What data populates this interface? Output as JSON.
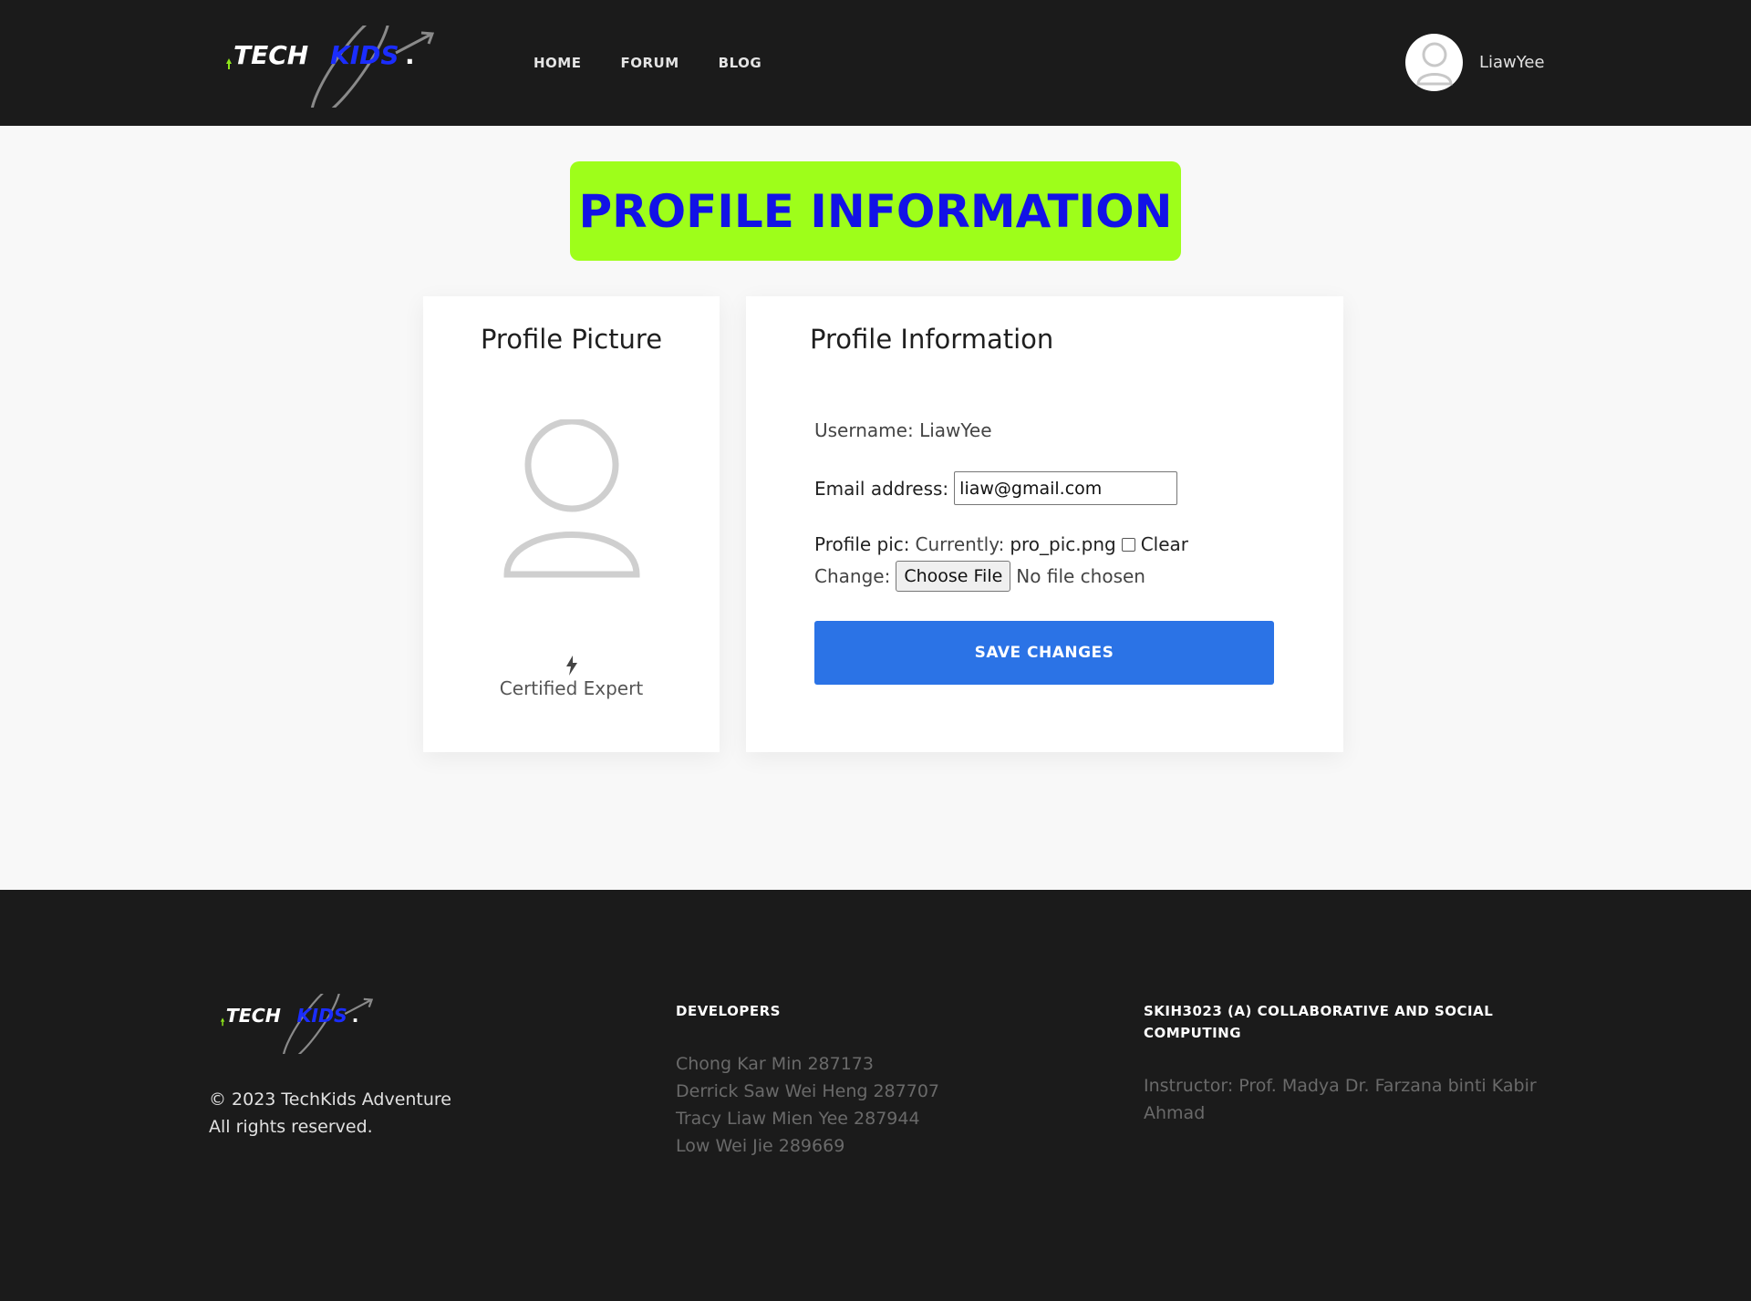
{
  "header": {
    "logo": {
      "part1": "TECH",
      "part2": "KIDS",
      "part3": "."
    },
    "nav": [
      "HOME",
      "FORUM",
      "BLOG"
    ],
    "user_name": "LiawYee"
  },
  "banner": {
    "title": "PROFILE INFORMATION"
  },
  "picture_card": {
    "title": "Profile Picture",
    "badge_icon": "bolt-icon",
    "badge_label": "Certified Expert"
  },
  "info_card": {
    "title": "Profile Information",
    "username_label": "Username:",
    "username_value": "LiawYee",
    "email_label": "Email address:",
    "email_value": "liaw@gmail.com",
    "pic_label": "Profile pic:",
    "currently_label": "Currently:",
    "current_file": "pro_pic.png",
    "clear_label": "Clear",
    "change_label": "Change:",
    "choose_file": "Choose File",
    "no_file": "No file chosen",
    "save_label": "SAVE CHANGES"
  },
  "footer": {
    "copyright": "© 2023 TechKids Adventure",
    "rights": "All rights reserved.",
    "developers_title": "DEVELOPERS",
    "developers": [
      "Chong Kar Min 287173",
      "Derrick Saw Wei Heng 287707",
      "Tracy Liaw Mien Yee 287944",
      "Low Wei Jie 289669"
    ],
    "course_title": "SKIH3023 (A) COLLABORATIVE AND SOCIAL COMPUTING",
    "instructor": "Instructor: Prof. Madya Dr. Farzana binti Kabir Ahmad"
  },
  "colors": {
    "header_bg": "#1b1b1b",
    "banner_bg": "#9efe1a",
    "banner_text": "#1212e6",
    "primary_button": "#2b73e6",
    "logo_kids": "#1b2dff",
    "logo_arrow": "#8ee61a"
  }
}
